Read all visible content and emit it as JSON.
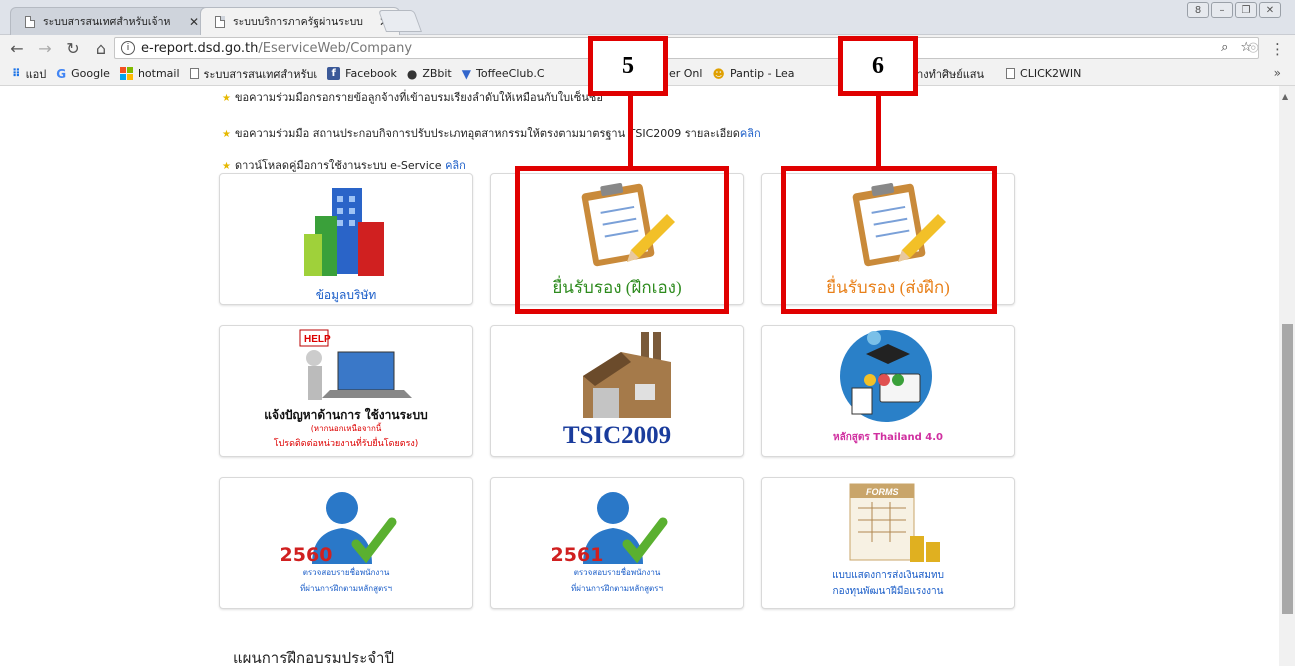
{
  "tabs": [
    {
      "title": "ระบบสารสนเทศสำหรับเจ้าห",
      "active": false
    },
    {
      "title": "ระบบบริการภาครัฐผ่านระบบ",
      "active": true
    }
  ],
  "window_controls": {
    "user": "8",
    "minimize": "–",
    "restore": "❐",
    "close": "✕"
  },
  "address": {
    "host": "e-report.dsd.go.th",
    "path": "/EserviceWeb/Company"
  },
  "bookmarks": [
    {
      "label": "แอป",
      "icon": "apps-icon"
    },
    {
      "label": "Google",
      "icon": "google-icon"
    },
    {
      "label": "hotmail",
      "icon": "microsoft-icon"
    },
    {
      "label": "ระบบสารสนเทศสำหรับเ",
      "icon": "doc-icon"
    },
    {
      "label": "Facebook",
      "icon": "facebook-icon"
    },
    {
      "label": "ZBbit",
      "icon": "zbbit-icon"
    },
    {
      "label": "ToffeeClub.C",
      "icon": "toffee-icon"
    },
    {
      "label": "- Manager Onl",
      "icon": "none"
    },
    {
      "label": "Pantip - Lea",
      "icon": "pantip-icon"
    },
    {
      "label": "32) ครูช่างทำศิษย์แสน",
      "icon": "none"
    },
    {
      "label": "CLICK2WIN",
      "icon": "doc-icon"
    }
  ],
  "notices": [
    {
      "text": "ขอความร่วมมือกรอกรายข้อลูกจ้างที่เข้าอบรมเรียงลำดับให้เหมือนกับใบเซ็นชื่อ",
      "link": ""
    },
    {
      "text": "ขอความร่วมมือ สถานประกอบกิจการปรับประเภทอุตสาหกรรมให้ตรงตามมาตรฐาน TSIC2009 รายละเอียด",
      "link": "คลิก"
    },
    {
      "text": "ดาวน์โหลดคู่มือการใช้งานระบบ e-Service",
      "link": "คลิก"
    }
  ],
  "cards": {
    "company": {
      "label": "ข้อมูลบริษัท"
    },
    "certify_self": {
      "label": "ยื่นรับรอง (ฝึกเอง)"
    },
    "certify_send": {
      "label": "ยื่นรับรอง (ส่งฝึก)"
    },
    "help": {
      "sign": "HELP",
      "title": "แจ้งปัญหาด้านการ ใช้งานระบบ",
      "line2": "(หากนอกเหนือจากนี้",
      "line3": "โปรดติดต่อหน่วยงานที่รับยื่นโดยตรง)"
    },
    "tsic": {
      "label": "TSIC2009"
    },
    "thailand40": {
      "label": "หลักสูตร Thailand 4.0"
    },
    "check2560": {
      "year": "2560",
      "line1": "ตรวจสอบรายชื่อพนักงาน",
      "line2": "ที่ผ่านการฝึกตามหลักสูตรฯ"
    },
    "check2561": {
      "year": "2561",
      "line1": "ตรวจสอบรายชื่อพนักงาน",
      "line2": "ที่ผ่านการฝึกตามหลักสูตรฯ"
    },
    "forms": {
      "badge": "FORMS",
      "line1": "แบบแสดงการส่งเงินสมทบ",
      "line2": "กองทุนพัฒนาฝีมือแรงงาน"
    }
  },
  "annotations": [
    "5",
    "6"
  ],
  "section_title": "แผนการฝึกอบรมประจำปี",
  "colors": {
    "annotation": "#e00000",
    "link": "#1a5dc8",
    "green_label": "#2e8b1e",
    "orange_label": "#e8801a",
    "blue_label": "#1a5dc8"
  }
}
